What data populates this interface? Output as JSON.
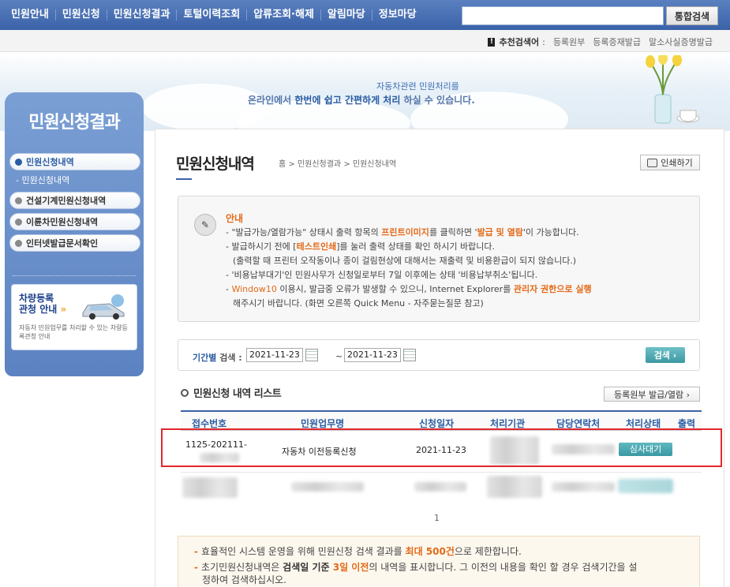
{
  "topnav": {
    "items": [
      "민원안내",
      "민원신청",
      "민원신청결과",
      "토털이력조회",
      "압류조회·해제",
      "알림마당",
      "정보마당"
    ],
    "search_placeholder": "",
    "search_button": "통합검색"
  },
  "recommend": {
    "label": "추천검색어",
    "links": [
      "등록원부",
      "등록증재발급",
      "말소사실증명발급"
    ]
  },
  "banner": {
    "line1": "자동차관련 민원처리를",
    "line2_prefix": "온라인에서 ",
    "line2_hl": "한번에 쉽고 간편하게 처리",
    "line2_suffix": " 하실 수 있습니다."
  },
  "sidebar": {
    "title": "민원신청결과",
    "items": [
      {
        "label": "민원신청내역",
        "active": true
      },
      {
        "label": "건설기계민원신청내역",
        "active": false
      },
      {
        "label": "이륜차민원신청내역",
        "active": false
      },
      {
        "label": "인터넷발급문서확인",
        "active": false
      }
    ],
    "sub_item": "민원신청내역",
    "promo": {
      "title_line1": "차량등록",
      "title_line2": "관청 안내",
      "desc": "자동차 민원업무를 처리할 수 있는 차량등록관청 안내"
    }
  },
  "page": {
    "title": "민원신청내역",
    "breadcrumb": "홈 > 민원신청결과 > 민원신청내역",
    "print_label": "인쇄하기"
  },
  "notice": {
    "title": "안내",
    "line1_a": "- \"발급가능/열람가능\" 상태시 출력 항목의 ",
    "line1_b": "프린트이미지",
    "line1_c": "를 클릭하면 '",
    "line1_d": "발급 및 열람",
    "line1_e": "'이 가능합니다.",
    "line2_a": "- 발급하시기 전에 [",
    "line2_b": "테스트인쇄",
    "line2_c": "]를 눌러 출력 상태를 확인 하시기 바랍니다.",
    "line3": "(출력할 때 프린터 오작동이나 종이 걸림현상에 대해서는 재출력 및 비용환급이 되지 않습니다.)",
    "line4": "- '비용납부대기'인 민원사무가 신청일로부터 7일 이후에는 상태 '비용납부취소'됩니다.",
    "line5_a": "- ",
    "line5_b": "Window10",
    "line5_c": " 이용시, 발급중 오류가 발생할 수 있으니, Internet Explorer를 ",
    "line5_d": "관리자 권한으로 실행",
    "line6": "해주시기 바랍니다. (화면 오른쪽 Quick Menu - 자주묻는질문 참고)"
  },
  "period": {
    "label_a": "기간별",
    "label_b": " 검색 :",
    "from": "2021-11-23",
    "tilde": "~",
    "to": "2021-11-23",
    "search_button": "검색 ›"
  },
  "list": {
    "title": "민원신청 내역 리스트",
    "reg_button": "등록원부 발급/열람  ›",
    "columns": [
      "접수번호",
      "민원업무명",
      "신청일자",
      "처리기관",
      "담당연락처",
      "처리상태",
      "출력"
    ],
    "rows": [
      {
        "receipt": "1125-202111-",
        "task": "자동차 이전등록신청",
        "date": "2021-11-23",
        "status": "심사대기"
      }
    ],
    "page_number": "1"
  },
  "bottom_notes": {
    "line1_a": "효율적인 시스템 운영을 위해 민원신청 검색 결과를 ",
    "line1_b": "최대 500건",
    "line1_c": "으로 제한합니다.",
    "line2_a": "초기민원신청내역은 ",
    "line2_b": "검색일 기준 ",
    "line2_c": "3일 이전",
    "line2_d": "의 내역을 표시합니다. 그 이전의 내용을 확인 할 경우 검색기간을 설",
    "line3": "정하여 검색하십시오."
  },
  "icons": {
    "notice": "notice-pencil-icon",
    "print": "printer-icon",
    "calendar": "calendar-icon"
  },
  "colors": {
    "nav_blue": "#3a62a8",
    "accent_orange": "#e36a19",
    "status_teal": "#3a98a2",
    "highlight_red": "#e0282e"
  }
}
